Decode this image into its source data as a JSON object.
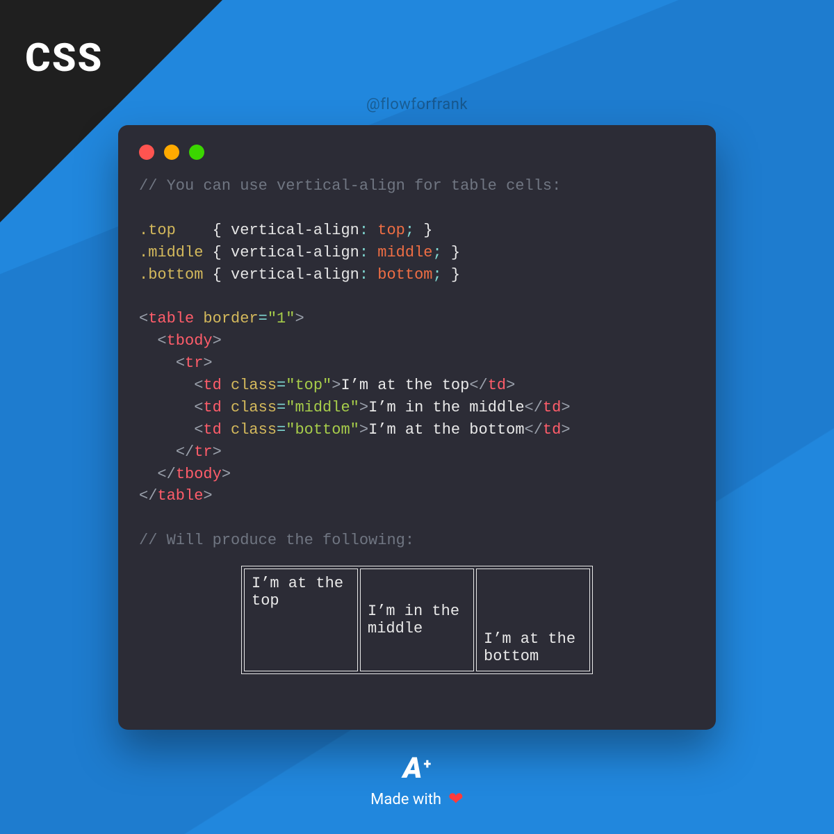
{
  "corner_label": "CSS",
  "handle": "@flowforfrank",
  "code": {
    "comment_top": "// You can use vertical-align for table cells:",
    "rule1_sel": ".top",
    "rule1_prop": "vertical-align",
    "rule1_val": "top",
    "rule2_sel": ".middle",
    "rule2_prop": "vertical-align",
    "rule2_val": "middle",
    "rule3_sel": ".bottom",
    "rule3_prop": "vertical-align",
    "rule3_val": "bottom",
    "tag_table": "table",
    "attr_border": "border",
    "attr_border_val": "\"1\"",
    "tag_tbody": "tbody",
    "tag_tr": "tr",
    "tag_td": "td",
    "attr_class": "class",
    "class_top": "\"top\"",
    "class_middle": "\"middle\"",
    "class_bottom": "\"bottom\"",
    "td_top_text": "I’m at the top",
    "td_middle_text": "I’m in the middle",
    "td_bottom_text": "I’m at the bottom",
    "comment_bottom": "// Will produce the following:"
  },
  "demo": {
    "cell_top": "I’m at the top",
    "cell_middle": "I’m in the middle",
    "cell_bottom": "I’m at the bottom"
  },
  "footer": {
    "logo_A": "A",
    "logo_plus": "+",
    "made_with": "Made with",
    "heart": "❤"
  }
}
